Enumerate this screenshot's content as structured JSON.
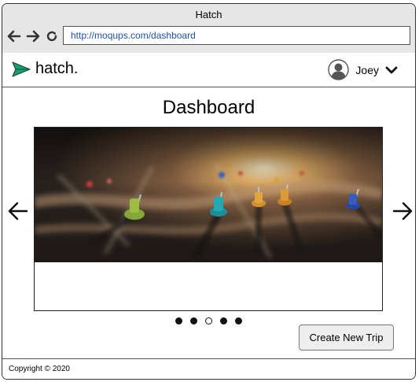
{
  "window": {
    "title": "Hatch"
  },
  "browser": {
    "url": "http://moqups.com/dashboard"
  },
  "header": {
    "logo_text": "hatch.",
    "user_name": "Joey"
  },
  "main": {
    "page_title": "Dashboard",
    "create_button_label": "Create New Trip"
  },
  "carousel": {
    "slide_count": 5,
    "active_index": 2
  },
  "footer": {
    "copyright": "Copyright © 2020"
  },
  "colors": {
    "logo_green": "#1c9c6f",
    "link_blue": "#1a4fbf",
    "titlebar_bg": "#e6e6e6"
  },
  "icons": [
    "arrow-left-icon",
    "arrow-right-icon",
    "refresh-icon",
    "paper-plane-icon",
    "avatar-icon",
    "chevron-down-icon",
    "carousel-prev-icon",
    "carousel-next-icon"
  ]
}
